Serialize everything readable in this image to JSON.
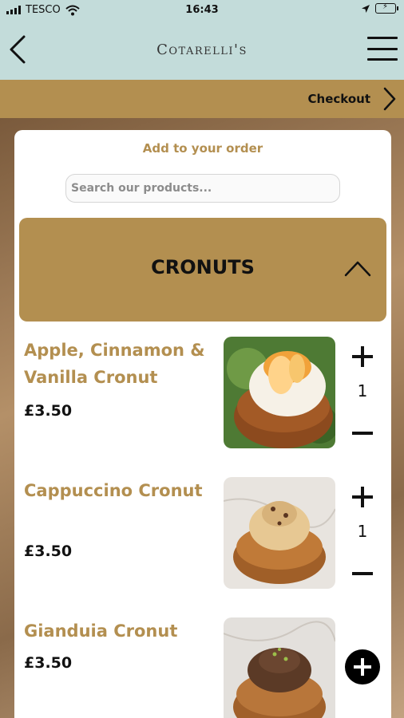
{
  "status_bar": {
    "carrier": "TESCO",
    "time": "16:43"
  },
  "header": {
    "title": "Cotarelli's",
    "back_icon": "chevron-left-icon",
    "menu_icon": "hamburger-menu-icon"
  },
  "checkout": {
    "label": "Checkout",
    "icon": "chevron-right-icon"
  },
  "order": {
    "heading": "Add to your order",
    "search_placeholder": "Search our products..."
  },
  "category": {
    "title": "CRONUTS",
    "expanded": true,
    "toggle_icon": "chevron-up-icon"
  },
  "products": [
    {
      "name": "Apple, Cinnamon & Vanilla Cronut",
      "price": "£3.50",
      "quantity": "1"
    },
    {
      "name": "Cappuccino Cronut",
      "price": "£3.50",
      "quantity": "1"
    },
    {
      "name": "Gianduia Cronut",
      "price": "£3.50"
    }
  ],
  "colors": {
    "accent": "#b38f50",
    "nav_background": "#c3dcda",
    "text": "#111111"
  }
}
